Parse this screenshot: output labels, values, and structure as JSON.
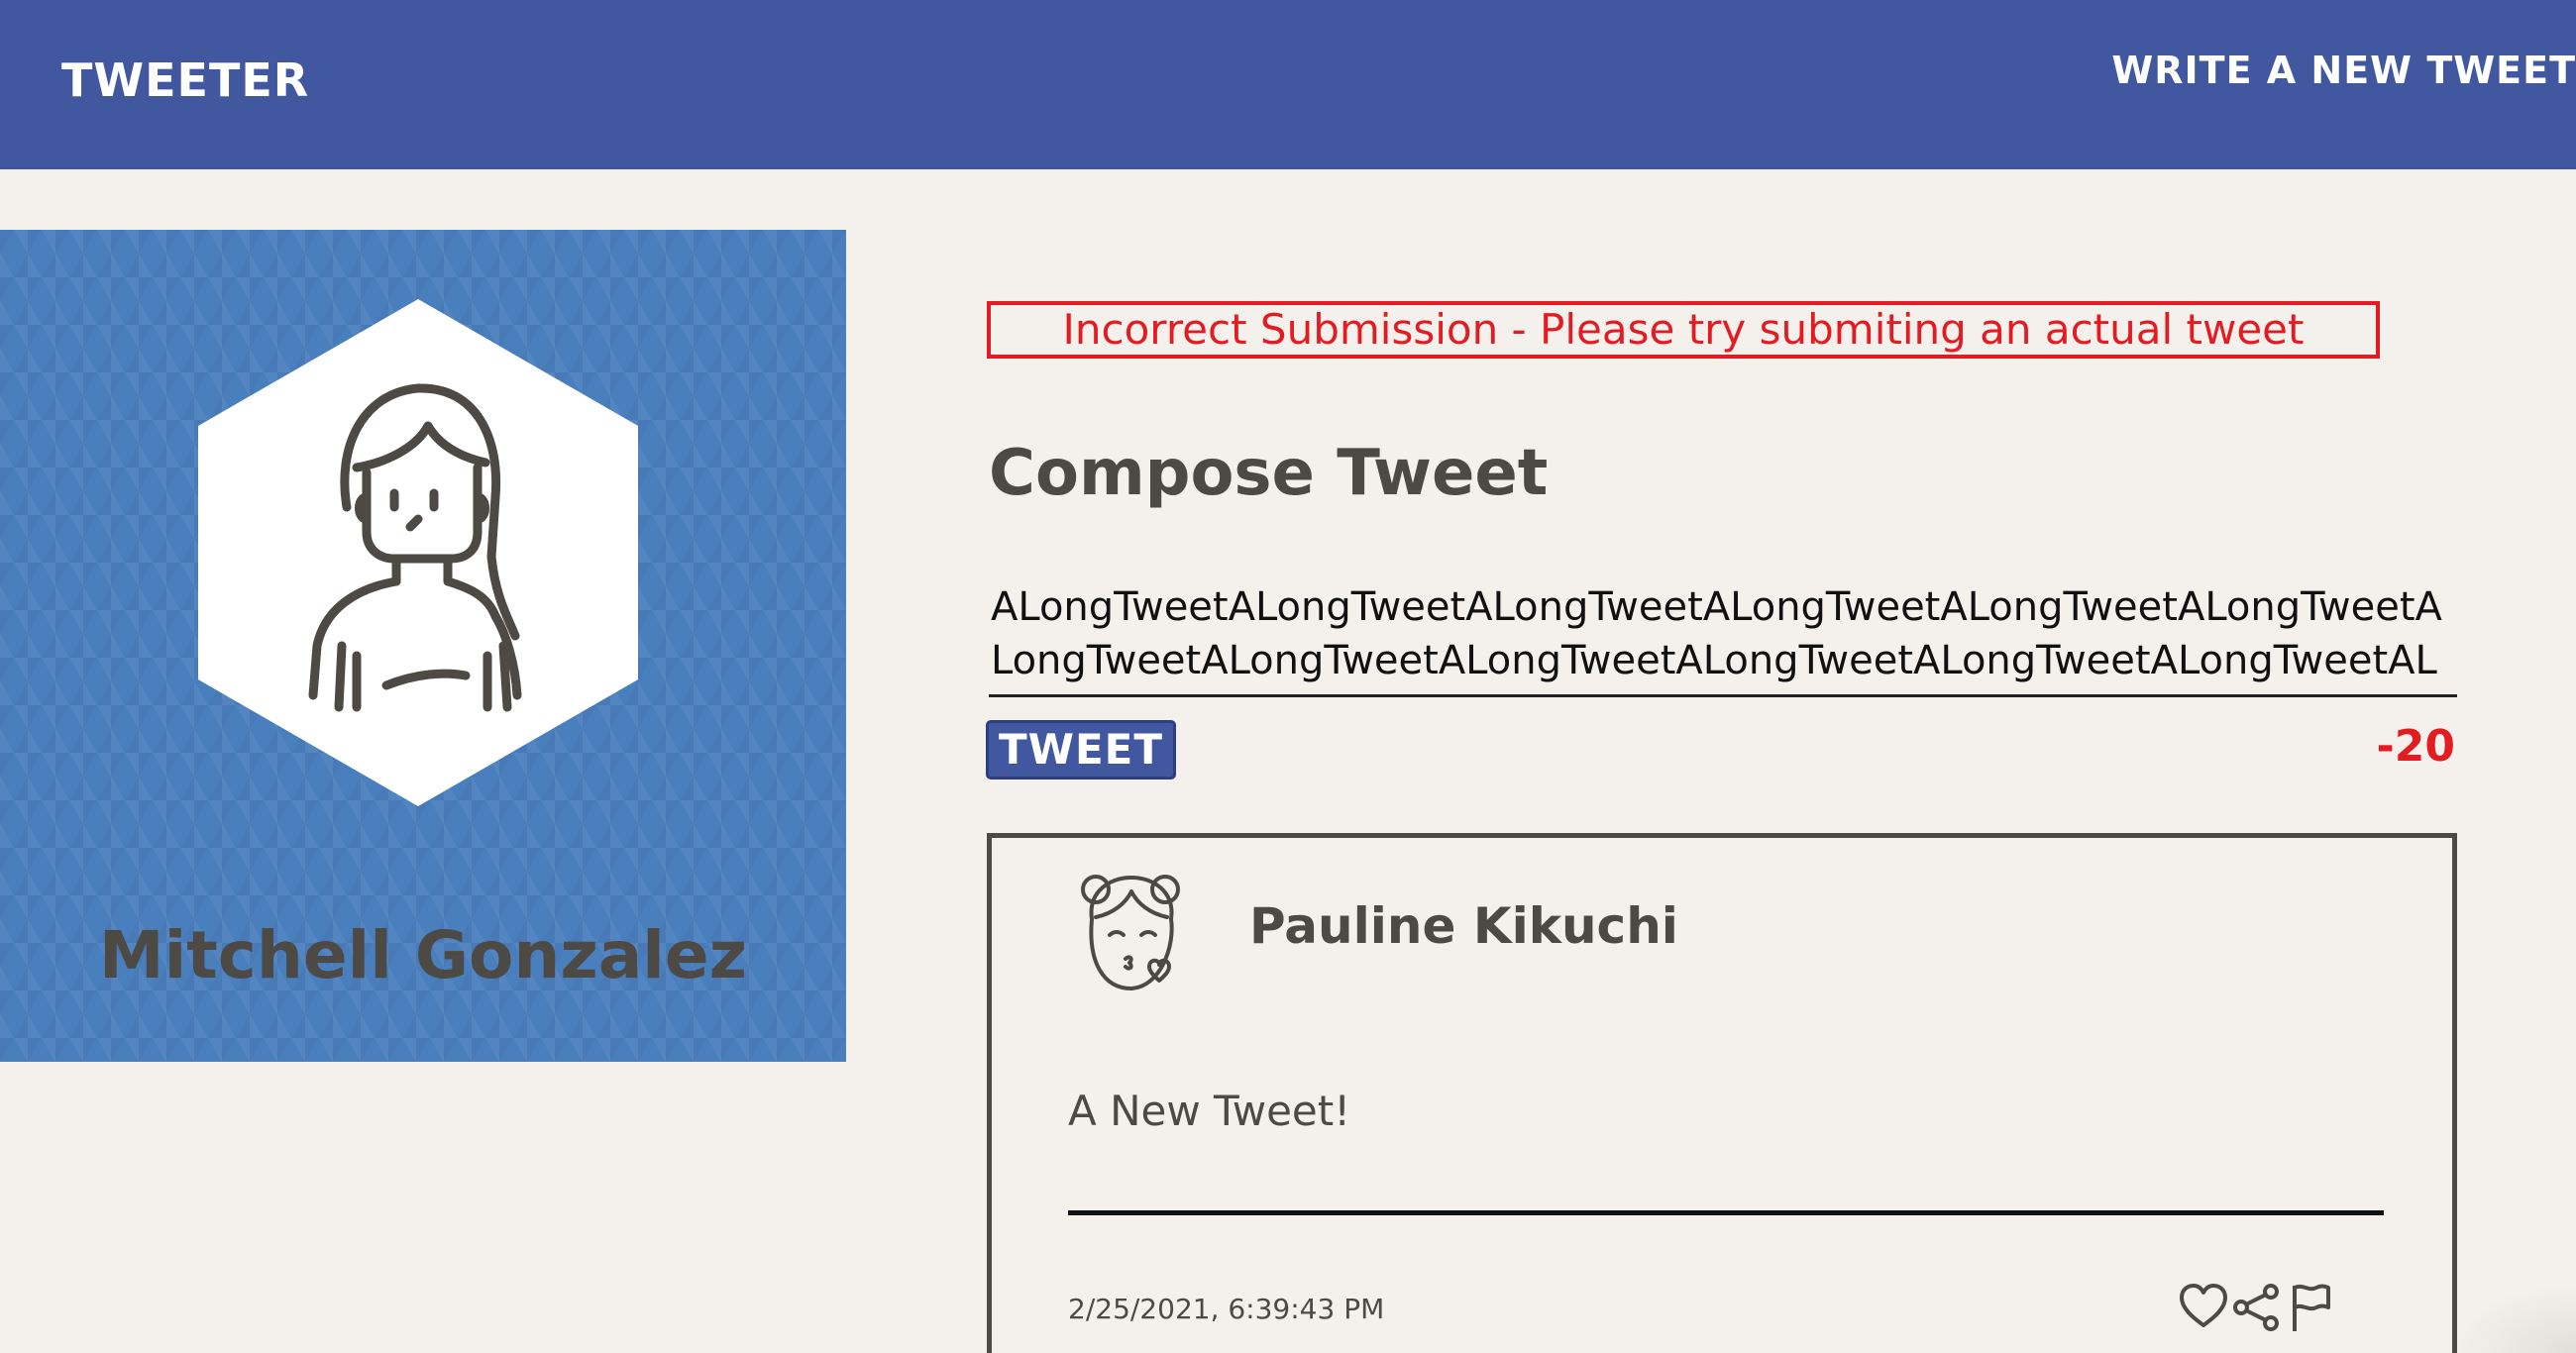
{
  "header": {
    "brand": "Tweeter",
    "write_link": "Write a new tweet"
  },
  "profile": {
    "name": "Mitchell Gonzalez",
    "avatar_icon": "user-avatar-icon"
  },
  "compose": {
    "error_message": "Incorrect Submission - Please try submiting an actual tweet",
    "title": "Compose Tweet",
    "tweet_text": "ALongTweetALongTweetALongTweetALongTweetALongTweetALongTweetALongTweetALongTweetALongTweetALongTweetALongTweetALongTweetALongTwe",
    "tweet_button": "Tweet",
    "counter": "-20"
  },
  "tweets": [
    {
      "author": "Pauline Kikuchi",
      "content": "A New Tweet!",
      "timestamp": "2/25/2021, 6:39:43 PM",
      "actions": [
        "heart-icon",
        "share-icon",
        "flag-icon"
      ]
    }
  ],
  "colors": {
    "header_bg": "#4157a0",
    "page_bg": "#f4f1ed",
    "profile_bg": "#4a7fbe",
    "text": "#4d4a45",
    "error": "#e31c23"
  }
}
